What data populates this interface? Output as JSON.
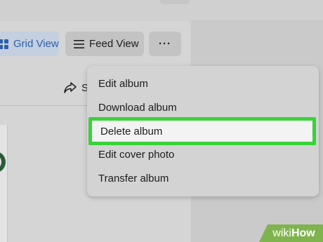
{
  "toolbar": {
    "grid_view_label": "Grid View",
    "feed_view_label": "Feed View",
    "more_label": "···",
    "share_label": "Share"
  },
  "menu": {
    "items": [
      {
        "label": "Edit album"
      },
      {
        "label": "Download album"
      },
      {
        "label": "Delete album"
      },
      {
        "label": "Edit cover photo"
      },
      {
        "label": "Transfer album"
      }
    ],
    "highlight_color": "#3ad13a"
  },
  "watermark": {
    "part1": "wiki",
    "part2": "How"
  },
  "colors": {
    "accent": "#2d5fa6",
    "watermark_bg": "#7fb34e"
  }
}
